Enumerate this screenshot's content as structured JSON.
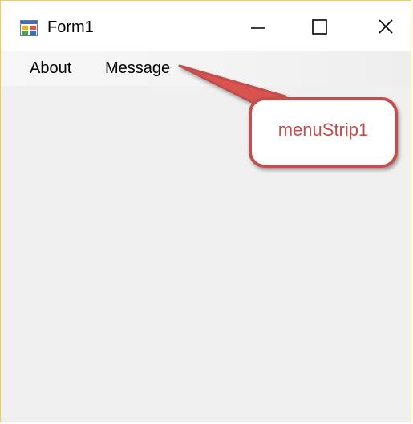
{
  "window": {
    "title": "Form1",
    "icon": "winforms-app-icon"
  },
  "title_bar_buttons": [
    {
      "name": "minimize",
      "icon": "minimize-icon"
    },
    {
      "name": "maximize",
      "icon": "maximize-icon"
    },
    {
      "name": "close",
      "icon": "close-icon"
    }
  ],
  "menu": {
    "items": [
      {
        "label": "About"
      },
      {
        "label": "Message"
      }
    ]
  },
  "annotation": {
    "text": "menuStrip1",
    "color": "#c0504d",
    "border_color": "#c0504d"
  }
}
